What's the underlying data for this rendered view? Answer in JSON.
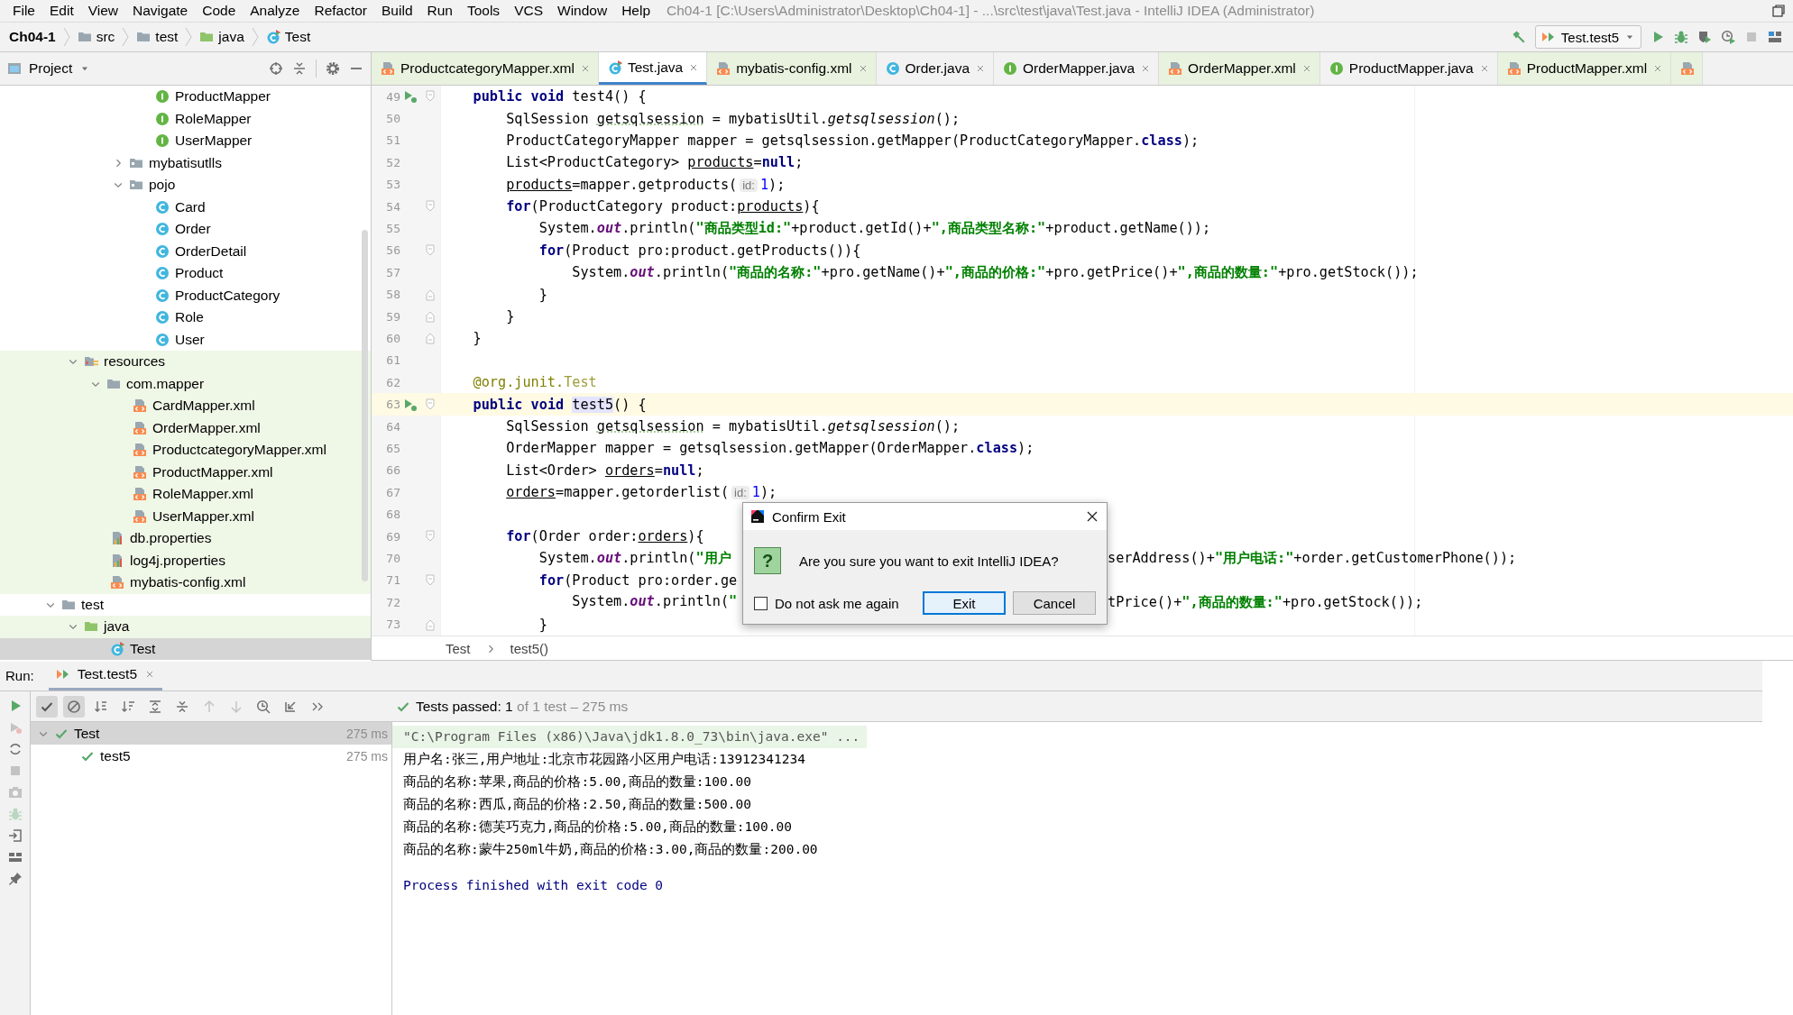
{
  "menu_bar": {
    "items": [
      "File",
      "Edit",
      "View",
      "Navigate",
      "Code",
      "Analyze",
      "Refactor",
      "Build",
      "Run",
      "Tools",
      "VCS",
      "Window",
      "Help"
    ],
    "title": "Ch04-1 [C:\\Users\\Administrator\\Desktop\\Ch04-1] - ...\\src\\test\\java\\Test.java - IntelliJ IDEA (Administrator)"
  },
  "navigation_bar": {
    "breadcrumbs": [
      {
        "label": "Ch04-1",
        "kind": "module"
      },
      {
        "label": "src",
        "kind": "folder"
      },
      {
        "label": "test",
        "kind": "folder"
      },
      {
        "label": "java",
        "kind": "test-root"
      },
      {
        "label": "Test",
        "kind": "test-class"
      }
    ],
    "build_tool": {
      "kind": "build",
      "disabled": false
    },
    "run_configuration": "Test.test5",
    "toolbar": [
      {
        "kind": "run",
        "disabled": false
      },
      {
        "kind": "debug",
        "disabled": false
      },
      {
        "kind": "coverage",
        "disabled": false
      },
      {
        "kind": "profile",
        "disabled": false
      },
      {
        "kind": "stop",
        "disabled": true
      },
      {
        "kind": "structure",
        "disabled": false
      }
    ]
  },
  "project_panel": {
    "title": "Project",
    "tree": [
      {
        "children": [
          {
            "children": [
              {
                "children": [
                  {
                    "children": [
                      {
                        "label": "ProductMapper",
                        "kind": "interface",
                        "tinted": false,
                        "selected": false
                      },
                      {
                        "label": "RoleMapper",
                        "kind": "interface",
                        "tinted": false,
                        "selected": false
                      },
                      {
                        "label": "UserMapper",
                        "kind": "interface",
                        "tinted": false,
                        "selected": false
                      }
                    ]
                  },
                  {
                    "label": "mybatisutlls",
                    "kind": "package",
                    "expanded": false,
                    "tinted": false,
                    "selected": false
                  },
                  {
                    "label": "pojo",
                    "kind": "package",
                    "expanded": true,
                    "tinted": false,
                    "selected": false,
                    "children": [
                      {
                        "label": "Card",
                        "kind": "class",
                        "tinted": false,
                        "selected": false
                      },
                      {
                        "label": "Order",
                        "kind": "class",
                        "tinted": false,
                        "selected": false
                      },
                      {
                        "label": "OrderDetail",
                        "kind": "class",
                        "tinted": false,
                        "selected": false
                      },
                      {
                        "label": "Product",
                        "kind": "class",
                        "tinted": false,
                        "selected": false
                      },
                      {
                        "label": "ProductCategory",
                        "kind": "class",
                        "tinted": false,
                        "selected": false
                      },
                      {
                        "label": "Role",
                        "kind": "class",
                        "tinted": false,
                        "selected": false
                      },
                      {
                        "label": "User",
                        "kind": "class",
                        "tinted": false,
                        "selected": false
                      }
                    ]
                  }
                ]
              }
            ]
          },
          {
            "label": "resources",
            "kind": "resources",
            "expanded": true,
            "tinted": true,
            "selected": false,
            "children": [
              {
                "label": "com.mapper",
                "kind": "folder",
                "expanded": true,
                "tinted": true,
                "selected": false,
                "children": [
                  {
                    "label": "CardMapper.xml",
                    "kind": "xml",
                    "tinted": true,
                    "selected": false
                  },
                  {
                    "label": "OrderMapper.xml",
                    "kind": "xml",
                    "tinted": true,
                    "selected": false
                  },
                  {
                    "label": "ProductcategoryMapper.xml",
                    "kind": "xml",
                    "tinted": true,
                    "selected": false
                  },
                  {
                    "label": "ProductMapper.xml",
                    "kind": "xml",
                    "tinted": true,
                    "selected": false
                  },
                  {
                    "label": "RoleMapper.xml",
                    "kind": "xml",
                    "tinted": true,
                    "selected": false
                  },
                  {
                    "label": "UserMapper.xml",
                    "kind": "xml",
                    "tinted": true,
                    "selected": false
                  }
                ]
              },
              {
                "label": "db.properties",
                "kind": "properties",
                "tinted": true,
                "selected": false
              },
              {
                "label": "log4j.properties",
                "kind": "properties",
                "tinted": true,
                "selected": false
              },
              {
                "label": "mybatis-config.xml",
                "kind": "xml",
                "tinted": true,
                "selected": false
              }
            ]
          }
        ]
      },
      {
        "label": "test",
        "kind": "folder",
        "expanded": true,
        "tinted": false,
        "selected": false,
        "children": [
          {
            "label": "java",
            "kind": "test-root",
            "expanded": true,
            "tinted": true,
            "selected": false,
            "children": [
              {
                "label": "Test",
                "kind": "test-class",
                "tinted": false,
                "selected": true
              }
            ]
          }
        ]
      }
    ]
  },
  "editor": {
    "tabs": [
      {
        "label": "ProductcategoryMapper.xml",
        "kind": "xml",
        "tinted": true,
        "selected": false
      },
      {
        "label": "Test.java",
        "kind": "test-class",
        "tinted": false,
        "selected": true
      },
      {
        "label": "mybatis-config.xml",
        "kind": "xml",
        "tinted": true,
        "selected": false
      },
      {
        "label": "Order.java",
        "kind": "class",
        "tinted": false,
        "selected": false
      },
      {
        "label": "OrderMapper.java",
        "kind": "interface",
        "tinted": false,
        "selected": false
      },
      {
        "label": "OrderMapper.xml",
        "kind": "xml",
        "tinted": true,
        "selected": false
      },
      {
        "label": "ProductMapper.java",
        "kind": "interface",
        "tinted": false,
        "selected": false
      },
      {
        "label": "ProductMapper.xml",
        "kind": "xml",
        "tinted": true,
        "selected": false
      },
      {
        "kind": "xml",
        "tinted": true,
        "selected": false
      }
    ],
    "lines": [
      {
        "number": "49",
        "run_marker": true,
        "fold_start": true,
        "fold_end": false,
        "current": false,
        "segments": [
          {
            "kind": "kw",
            "text": "    public"
          },
          {
            "kind": "kw",
            "text": " void"
          },
          {
            "kind": "plain",
            "text": " test4() {"
          }
        ]
      },
      {
        "number": "50",
        "run_marker": false,
        "fold_start": false,
        "fold_end": false,
        "current": false,
        "segments": [
          {
            "kind": "plain",
            "text": "        SqlSession "
          },
          {
            "kind": "typo",
            "text": "getsqlsession"
          },
          {
            "kind": "plain",
            "text": " = mybatisUtil."
          },
          {
            "kind": "static",
            "text": "getsqlsession"
          },
          {
            "kind": "plain",
            "text": "();"
          }
        ]
      },
      {
        "number": "51",
        "run_marker": false,
        "fold_start": false,
        "fold_end": false,
        "current": false,
        "segments": [
          {
            "kind": "plain",
            "text": "        ProductCategoryMapper mapper = getsqlsession.getMapper(ProductCategoryMapper."
          },
          {
            "kind": "kw",
            "text": "class"
          },
          {
            "kind": "plain",
            "text": ");"
          }
        ]
      },
      {
        "number": "52",
        "run_marker": false,
        "fold_start": false,
        "fold_end": false,
        "current": false,
        "segments": [
          {
            "kind": "plain",
            "text": "        List<ProductCategory> "
          },
          {
            "kind": "var",
            "text": "products"
          },
          {
            "kind": "plain",
            "text": "="
          },
          {
            "kind": "kw",
            "text": "null"
          },
          {
            "kind": "plain",
            "text": ";"
          }
        ]
      },
      {
        "number": "53",
        "run_marker": false,
        "fold_start": false,
        "fold_end": false,
        "current": false,
        "segments": [
          {
            "kind": "var",
            "text": "        products"
          },
          {
            "kind": "plain",
            "text": "=mapper.getproducts("
          },
          {
            "kind": "hint",
            "text": "id:"
          },
          {
            "kind": "num",
            "text": "1"
          },
          {
            "kind": "plain",
            "text": ");"
          }
        ]
      },
      {
        "number": "54",
        "run_marker": false,
        "fold_start": true,
        "fold_end": false,
        "current": false,
        "segments": [
          {
            "kind": "kw",
            "text": "        for"
          },
          {
            "kind": "plain",
            "text": "(ProductCategory product:"
          },
          {
            "kind": "var",
            "text": "products"
          },
          {
            "kind": "plain",
            "text": "){"
          }
        ]
      },
      {
        "number": "55",
        "run_marker": false,
        "fold_start": false,
        "fold_end": false,
        "current": false,
        "segments": [
          {
            "kind": "plain",
            "text": "            System."
          },
          {
            "kind": "field",
            "text": "out"
          },
          {
            "kind": "plain",
            "text": ".println("
          },
          {
            "kind": "str",
            "text": "\"商品类型id:\""
          },
          {
            "kind": "plain",
            "text": "+product.getId()+"
          },
          {
            "kind": "str",
            "text": "\",商品类型名称:\""
          },
          {
            "kind": "plain",
            "text": "+product.getName());"
          }
        ]
      },
      {
        "number": "56",
        "run_marker": false,
        "fold_start": true,
        "fold_end": false,
        "current": false,
        "segments": [
          {
            "kind": "kw",
            "text": "            for"
          },
          {
            "kind": "plain",
            "text": "(Product pro:product.getProducts()){"
          }
        ]
      },
      {
        "number": "57",
        "run_marker": false,
        "fold_start": false,
        "fold_end": false,
        "current": false,
        "segments": [
          {
            "kind": "plain",
            "text": "                System."
          },
          {
            "kind": "field",
            "text": "out"
          },
          {
            "kind": "plain",
            "text": ".println("
          },
          {
            "kind": "str",
            "text": "\"商品的名称:\""
          },
          {
            "kind": "plain",
            "text": "+pro.getName()+"
          },
          {
            "kind": "str",
            "text": "\",商品的价格:\""
          },
          {
            "kind": "plain",
            "text": "+pro.getPrice()+"
          },
          {
            "kind": "str",
            "text": "\",商品的数量:\""
          },
          {
            "kind": "plain",
            "text": "+pro.getStock());"
          }
        ]
      },
      {
        "number": "58",
        "run_marker": false,
        "fold_start": false,
        "fold_end": true,
        "current": false,
        "segments": [
          {
            "kind": "plain",
            "text": "            }"
          }
        ]
      },
      {
        "number": "59",
        "run_marker": false,
        "fold_start": false,
        "fold_end": true,
        "current": false,
        "segments": [
          {
            "kind": "plain",
            "text": "        }"
          }
        ]
      },
      {
        "number": "60",
        "run_marker": false,
        "fold_start": false,
        "fold_end": true,
        "current": false,
        "segments": [
          {
            "kind": "plain",
            "text": "    }"
          }
        ]
      },
      {
        "number": "61",
        "run_marker": false,
        "fold_start": false,
        "fold_end": false,
        "current": false
      },
      {
        "number": "62",
        "run_marker": false,
        "fold_start": false,
        "fold_end": false,
        "current": false,
        "segments": [
          {
            "kind": "ann",
            "text": "    @org.junit."
          },
          {
            "kind": "annref",
            "text": "Test"
          }
        ]
      },
      {
        "number": "63",
        "run_marker": true,
        "fold_start": true,
        "fold_end": false,
        "current": true,
        "segments": [
          {
            "kind": "kw",
            "text": "    public"
          },
          {
            "kind": "kw",
            "text": " void"
          },
          {
            "kind": "caret",
            "text": " test5"
          },
          {
            "kind": "plain",
            "text": "() {"
          }
        ]
      },
      {
        "number": "64",
        "run_marker": false,
        "fold_start": false,
        "fold_end": false,
        "current": false,
        "segments": [
          {
            "kind": "plain",
            "text": "        SqlSession "
          },
          {
            "kind": "typo",
            "text": "getsqlsession"
          },
          {
            "kind": "plain",
            "text": " = mybatisUtil."
          },
          {
            "kind": "static",
            "text": "getsqlsession"
          },
          {
            "kind": "plain",
            "text": "();"
          }
        ]
      },
      {
        "number": "65",
        "run_marker": false,
        "fold_start": false,
        "fold_end": false,
        "current": false,
        "segments": [
          {
            "kind": "plain",
            "text": "        OrderMapper mapper = getsqlsession.getMapper(OrderMapper."
          },
          {
            "kind": "kw",
            "text": "class"
          },
          {
            "kind": "plain",
            "text": ");"
          }
        ]
      },
      {
        "number": "66",
        "run_marker": false,
        "fold_start": false,
        "fold_end": false,
        "current": false,
        "segments": [
          {
            "kind": "plain",
            "text": "        List<Order> "
          },
          {
            "kind": "var",
            "text": "orders"
          },
          {
            "kind": "plain",
            "text": "="
          },
          {
            "kind": "kw",
            "text": "null"
          },
          {
            "kind": "plain",
            "text": ";"
          }
        ]
      },
      {
        "number": "67",
        "run_marker": false,
        "fold_start": false,
        "fold_end": false,
        "current": false,
        "segments": [
          {
            "kind": "var",
            "text": "        orders"
          },
          {
            "kind": "plain",
            "text": "=mapper.getorderlist("
          },
          {
            "kind": "hint",
            "text": "id:"
          },
          {
            "kind": "num",
            "text": "1"
          },
          {
            "kind": "plain",
            "text": ");"
          }
        ]
      },
      {
        "number": "68",
        "run_marker": false,
        "fold_start": false,
        "fold_end": false,
        "current": false
      },
      {
        "number": "69",
        "run_marker": false,
        "fold_start": true,
        "fold_end": false,
        "current": false,
        "segments": [
          {
            "kind": "kw",
            "text": "        for"
          },
          {
            "kind": "plain",
            "text": "(Order order:"
          },
          {
            "kind": "var",
            "text": "orders"
          },
          {
            "kind": "plain",
            "text": "){"
          }
        ]
      },
      {
        "number": "70",
        "run_marker": false,
        "fold_start": false,
        "fold_end": false,
        "current": false,
        "segments": [
          {
            "kind": "plain",
            "text": "            System."
          },
          {
            "kind": "field",
            "text": "out"
          },
          {
            "kind": "plain",
            "text": ".println("
          },
          {
            "kind": "str",
            "text": "\"用户"
          }
        ],
        "after_dialog": [
          {
            "kind": "plain",
            "text": "serAddress()+"
          },
          {
            "kind": "str",
            "text": "\"用户电话:\""
          },
          {
            "kind": "plain",
            "text": "+order.getCustomerPhone());"
          }
        ]
      },
      {
        "number": "71",
        "run_marker": false,
        "fold_start": true,
        "fold_end": false,
        "current": false,
        "segments": [
          {
            "kind": "kw",
            "text": "            for"
          },
          {
            "kind": "plain",
            "text": "(Product pro:order.ge"
          }
        ]
      },
      {
        "number": "72",
        "run_marker": false,
        "fold_start": false,
        "fold_end": false,
        "current": false,
        "segments": [
          {
            "kind": "plain",
            "text": "                System."
          },
          {
            "kind": "field",
            "text": "out"
          },
          {
            "kind": "plain",
            "text": ".println("
          },
          {
            "kind": "str",
            "text": "\""
          }
        ],
        "after_dialog": [
          {
            "kind": "plain",
            "text": "tPrice()+"
          },
          {
            "kind": "str",
            "text": "\",商品的数量:\""
          },
          {
            "kind": "plain",
            "text": "+pro.getStock());"
          }
        ]
      },
      {
        "number": "73",
        "run_marker": false,
        "fold_start": false,
        "fold_end": true,
        "current": false,
        "segments": [
          {
            "kind": "plain",
            "text": "            }"
          }
        ]
      }
    ],
    "breadcrumbs": [
      "Test",
      "test5()"
    ]
  },
  "dialog": {
    "title": "Confirm Exit",
    "icon_glyph": "?",
    "message": "Are you sure you want to exit IntelliJ IDEA?",
    "checkbox": {
      "label": "Do not ask me again",
      "checked": false
    },
    "buttons": [
      {
        "label": "Exit",
        "default": true
      },
      {
        "label": "Cancel",
        "default": false
      }
    ]
  },
  "run_panel": {
    "label": "Run:",
    "tab": "Test.test5",
    "side_tools": [
      {
        "kind": "run",
        "disabled": false
      },
      {
        "kind": "rerun-failed",
        "disabled": true
      },
      {
        "kind": "auto-test",
        "disabled": false
      },
      {
        "kind": "stop",
        "disabled": true
      },
      {
        "kind": "camera",
        "disabled": true
      },
      {
        "kind": "debug",
        "disabled": true
      },
      {
        "kind": "exit",
        "disabled": false
      },
      {
        "kind": "layout",
        "disabled": false
      },
      {
        "kind": "pin",
        "disabled": false
      }
    ],
    "toolbar": [
      {
        "kind": "show-passed",
        "toggled": true,
        "disabled": false
      },
      {
        "kind": "ban",
        "toggled": true,
        "disabled": false
      },
      {
        "kind": "sort-alpha",
        "toggled": false,
        "disabled": false
      },
      {
        "kind": "sort-duration",
        "toggled": false,
        "disabled": false
      },
      {
        "kind": "expand-all",
        "toggled": false,
        "disabled": false
      },
      {
        "kind": "collapse-all",
        "toggled": false,
        "disabled": false
      },
      {
        "kind": "up",
        "toggled": false,
        "disabled": true
      },
      {
        "kind": "down",
        "toggled": false,
        "disabled": true
      },
      {
        "kind": "history",
        "toggled": false,
        "disabled": false
      },
      {
        "kind": "export",
        "toggled": false,
        "disabled": false
      },
      {
        "kind": "more",
        "toggled": false,
        "disabled": false
      }
    ],
    "status": {
      "summary": "Tests passed: 1",
      "detail": "of 1 test – 275 ms",
      "passed": true
    },
    "tests": [
      {
        "name": "Test",
        "time": "275 ms",
        "passed": true,
        "selected": true,
        "expanded": true,
        "children": [
          {
            "name": "test5",
            "time": "275 ms",
            "passed": true,
            "selected": false
          }
        ]
      }
    ],
    "console": [
      {
        "kind": "command",
        "text": "\"C:\\Program Files (x86)\\Java\\jdk1.8.0_73\\bin\\java.exe\" ..."
      },
      {
        "kind": "output",
        "text": "用户名:张三,用户地址:北京市花园路小区用户电话:13912341234"
      },
      {
        "kind": "output",
        "text": "商品的名称:苹果,商品的价格:5.00,商品的数量:100.00"
      },
      {
        "kind": "output",
        "text": "商品的名称:西瓜,商品的价格:2.50,商品的数量:500.00"
      },
      {
        "kind": "output",
        "text": "商品的名称:德芙巧克力,商品的价格:5.00,商品的数量:100.00"
      },
      {
        "kind": "output",
        "text": "商品的名称:蒙牛250ml牛奶,商品的价格:3.00,商品的数量:200.00"
      },
      {
        "kind": "exit",
        "text": "Process finished with exit code 0"
      }
    ]
  }
}
